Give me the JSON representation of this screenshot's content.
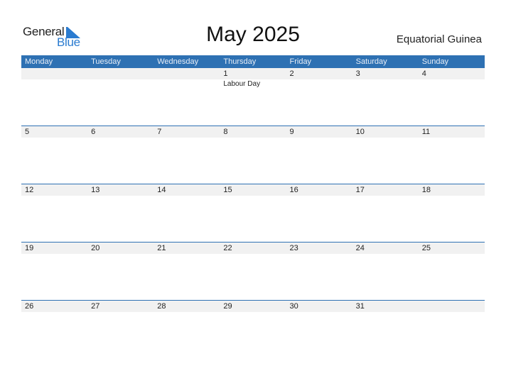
{
  "logo": {
    "part1": "General",
    "part2": "Blue"
  },
  "title": "May 2025",
  "country": "Equatorial Guinea",
  "colors": {
    "header_bg": "#2e71b3",
    "band_bg": "#f1f1f1",
    "logo_blue": "#2a7bd0"
  },
  "weekdays": [
    "Monday",
    "Tuesday",
    "Wednesday",
    "Thursday",
    "Friday",
    "Saturday",
    "Sunday"
  ],
  "weeks": [
    {
      "days": [
        "",
        "",
        "",
        "1",
        "2",
        "3",
        "4"
      ],
      "events": [
        "",
        "",
        "",
        "Labour Day",
        "",
        "",
        ""
      ]
    },
    {
      "days": [
        "5",
        "6",
        "7",
        "8",
        "9",
        "10",
        "11"
      ],
      "events": [
        "",
        "",
        "",
        "",
        "",
        "",
        ""
      ]
    },
    {
      "days": [
        "12",
        "13",
        "14",
        "15",
        "16",
        "17",
        "18"
      ],
      "events": [
        "",
        "",
        "",
        "",
        "",
        "",
        ""
      ]
    },
    {
      "days": [
        "19",
        "20",
        "21",
        "22",
        "23",
        "24",
        "25"
      ],
      "events": [
        "",
        "",
        "",
        "",
        "",
        "",
        ""
      ]
    },
    {
      "days": [
        "26",
        "27",
        "28",
        "29",
        "30",
        "31",
        ""
      ],
      "events": [
        "",
        "",
        "",
        "",
        "",
        "",
        ""
      ]
    }
  ]
}
